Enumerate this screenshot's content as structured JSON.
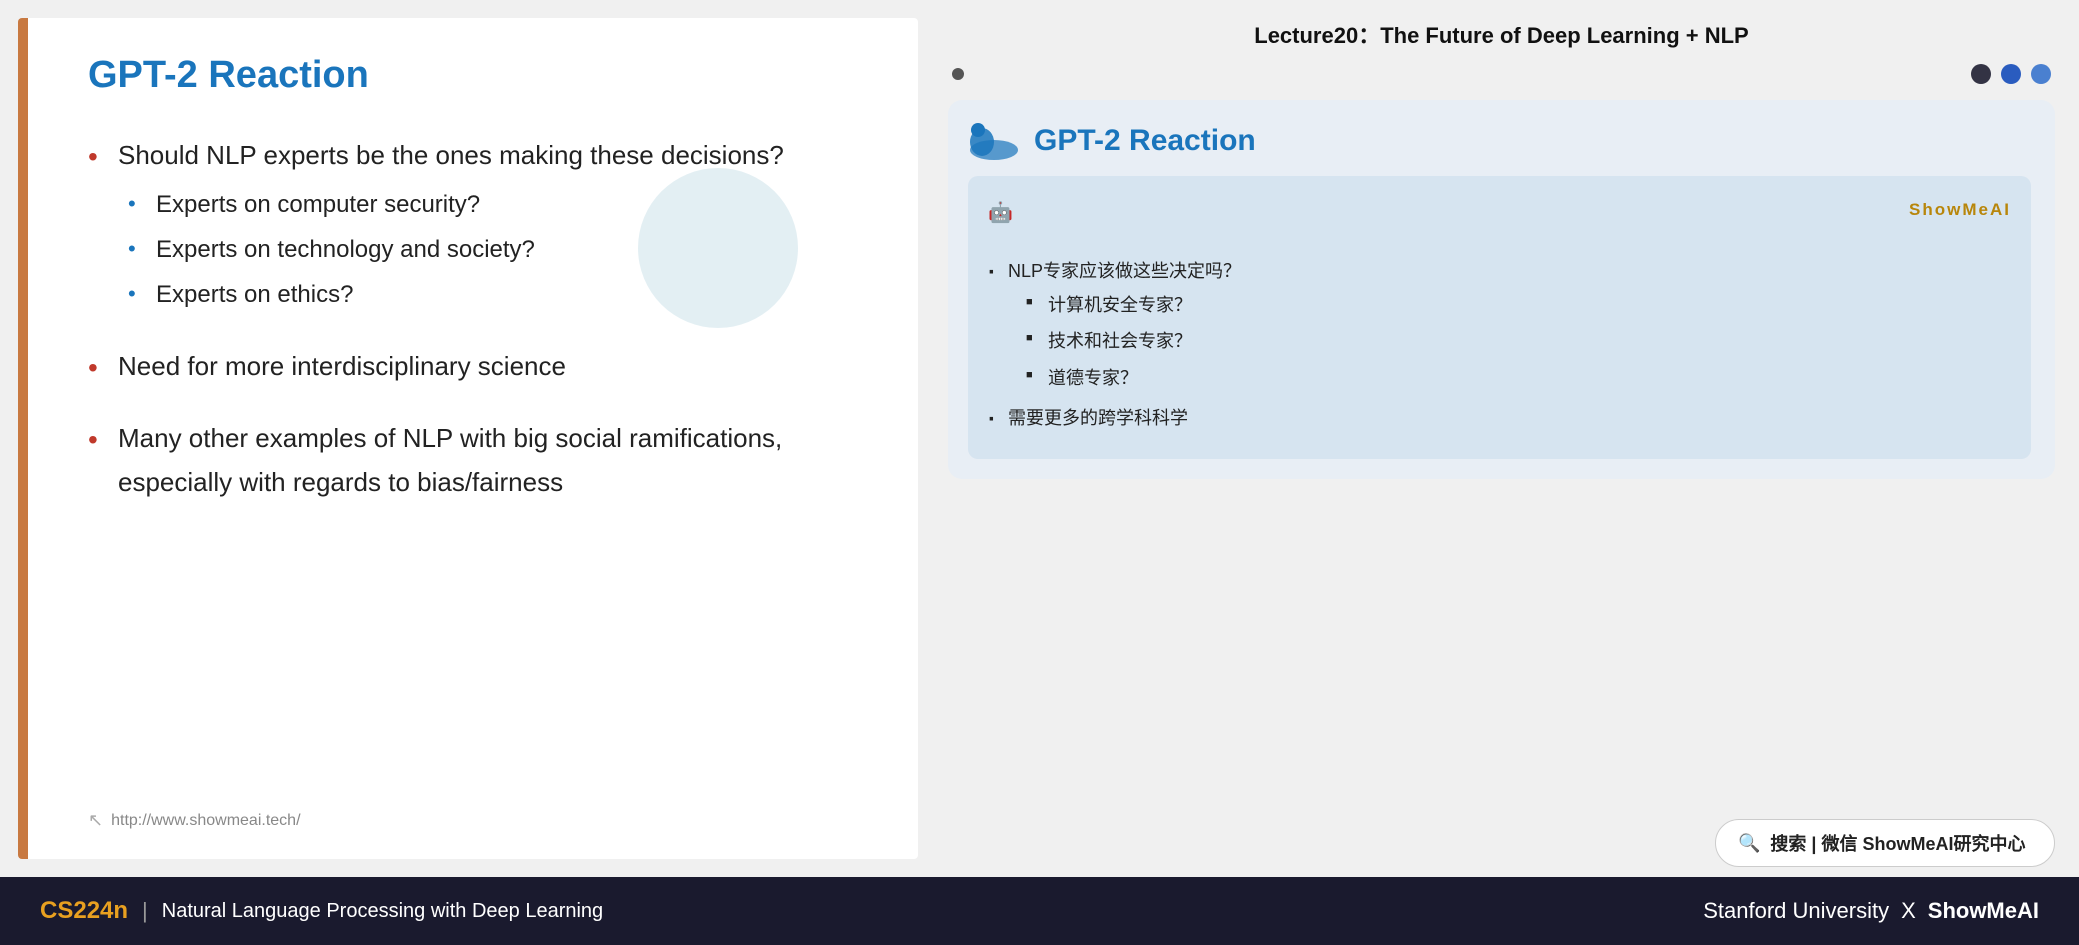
{
  "lecture": {
    "title": "Lecture20：The Future of Deep Learning + NLP"
  },
  "slide": {
    "title": "GPT-2 Reaction",
    "bullets": [
      {
        "text": "Should NLP experts be the ones making these decisions?",
        "sub": [
          "Experts on computer security?",
          "Experts on technology and society?",
          "Experts on ethics?"
        ]
      },
      {
        "text": "Need for more interdisciplinary science",
        "sub": []
      },
      {
        "text": "Many other examples of NLP with big social ramifications, especially with regards to bias/fairness",
        "sub": []
      }
    ],
    "footer_url": "http://www.showmeai.tech/"
  },
  "annotation": {
    "slide_title": "GPT-2 Reaction",
    "brand": "ShowMeAI",
    "bullets": [
      {
        "text": "NLP专家应该做这些决定吗？",
        "sub": [
          "计算机安全专家？",
          "技术和社会专家？",
          "道德专家？"
        ]
      },
      {
        "text": "需要更多的跨学科科学",
        "sub": []
      }
    ]
  },
  "search": {
    "label": "搜索 | 微信 ShowMeAI研究中心",
    "placeholder": "搜索 | 微信 ShowMeAI研究中心"
  },
  "footer": {
    "course": "CS224n",
    "separator": "|",
    "description": "Natural Language Processing with Deep Learning",
    "university": "Stanford University",
    "x": "X",
    "brand": "ShowMeAI"
  },
  "dots": {
    "nav_dot": "•"
  }
}
